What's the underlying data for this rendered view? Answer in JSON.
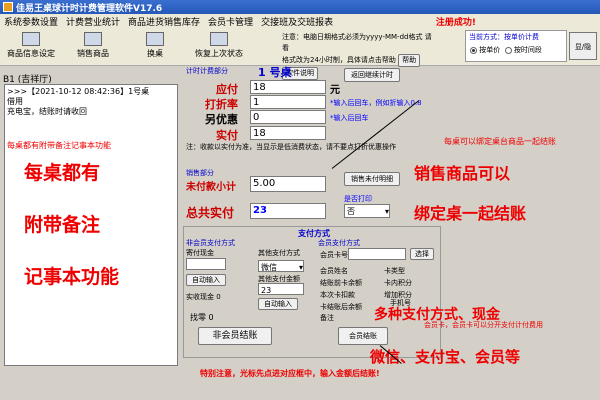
{
  "title": "佳易王桌球计时计费管理软件V17.6",
  "menu": [
    "系统参数设置",
    "计费营业统计",
    "商品进货销售库存",
    "会员卡管理",
    "交接班及交班报表"
  ],
  "registered": "注册成功!",
  "toolbar": [
    {
      "label": "商品信息设定"
    },
    {
      "label": "销售商品"
    },
    {
      "label": "换桌"
    },
    {
      "label": "恢复上次状态"
    }
  ],
  "notice": {
    "line1": "注意：电脑日期格式必须为yyyy-MM-dd格式 请看",
    "line2": "格式改为24小时制，具体请点击帮助",
    "help_btn": "帮助",
    "usage_btn": "软件说明"
  },
  "mode": {
    "label": "当前方式：按单价计费",
    "opt1": "按单价",
    "opt2": "按时间段"
  },
  "toggle_btn": "显/隐",
  "left": {
    "title": "B1  (吉祥厅)",
    "memo_line1": ">>>【2021-10-12 08:42:36】1号桌",
    "memo_line2": "借用",
    "memo_line3": "充电宝，结账时请收回",
    "memo_hint": "每桌都有附带备注记事本功能"
  },
  "overlay": {
    "left1": "每桌都有",
    "left2": "附带备注",
    "left3": "记事本功能",
    "right1": "每桌可以绑定桌台商品一起结账",
    "right2": "销售商品可以",
    "right3": "绑定桌一起结账",
    "pay1": "多种支付方式、现金",
    "pay2": "微信、支付宝、会员等"
  },
  "billing": {
    "section": "计时计费部分",
    "table": "1      号桌",
    "back_btn": "返回继续计时",
    "due_label": "应付",
    "due_value": "18",
    "unit": "元",
    "discount_label": "打折率",
    "discount_value": "1",
    "discount_hint": "*输入后回车，例如折输入0.8",
    "extra_label": "另优惠",
    "extra_value": "0",
    "extra_hint": "*输入后回车",
    "actual_label": "实付",
    "actual_value": "18",
    "note": "注：收款以实付为准，当显示是低消费状态，请不要点打折优惠操作"
  },
  "sales": {
    "section": "销售部分",
    "unpaid_label": "未付款小计",
    "unpaid_value": "5.00",
    "detail_btn": "销售未付明细"
  },
  "total": {
    "label": "总共实付",
    "value": "23",
    "print_label": "是否打印",
    "print_value": "否"
  },
  "payment": {
    "title": "支付方式",
    "nonmember": "非会员支付方式",
    "cash_label": "寄付现金",
    "auto_btn": "自动输入",
    "cash_shown": "实收现金 0",
    "change": "找零   0",
    "other": "其他支付方式",
    "other_select": "微信",
    "other_amount_label": "其他支付金额",
    "other_amount": "23",
    "auto_btn2": "自动输入",
    "member": "会员支付方式",
    "card_label": "会员卡号",
    "select_btn": "选择",
    "name_label": "会员姓名",
    "type_label": "卡类型",
    "balance_label": "结账前卡余额",
    "points_label": "卡内积分",
    "deduct_label": "本次卡扣款",
    "addpoints_label": "增加积分",
    "after_label": "卡结账后余额",
    "phone_label": "手机号",
    "remark_label": "备注",
    "member_hint": "会员卡，会员卡可以分开支付计付费用",
    "nonmember_btn": "非会员结账",
    "member_btn": "会员结账"
  },
  "bottom_note": "特别注意，光标先点进对应框中，输入金额后结账!"
}
